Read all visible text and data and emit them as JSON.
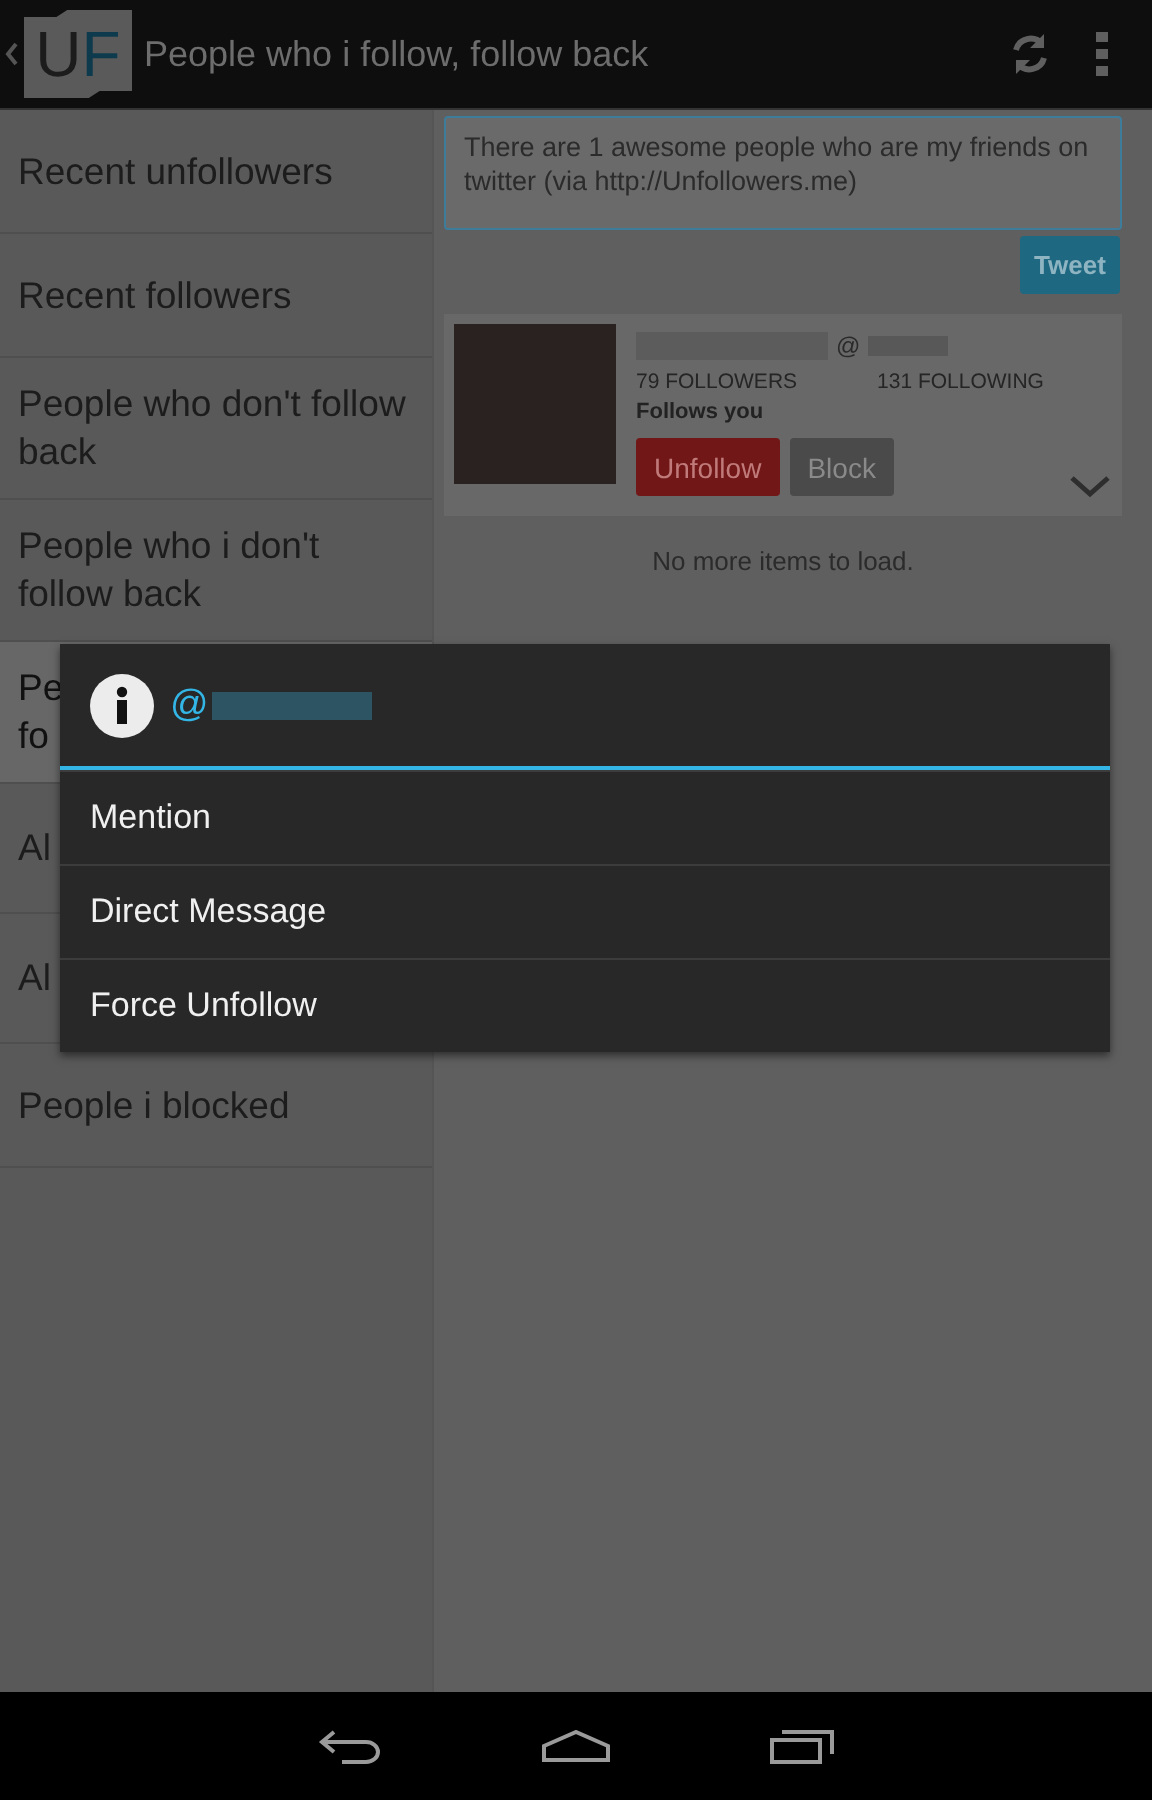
{
  "app_bar": {
    "logo_letters": [
      "U",
      "F"
    ],
    "title": "People who i follow, follow back"
  },
  "sidebar": {
    "items": [
      {
        "lines": [
          "Recent unfollowers"
        ],
        "selected": false
      },
      {
        "lines": [
          "Recent followers"
        ],
        "selected": false
      },
      {
        "lines": [
          "People who don't follow",
          "back"
        ],
        "selected": false
      },
      {
        "lines": [
          "People who i don't",
          "follow back"
        ],
        "selected": false
      },
      {
        "lines": [
          "Pe",
          "fo"
        ],
        "selected": true
      },
      {
        "lines": [
          "Al"
        ],
        "selected": false
      },
      {
        "lines": [
          "Al"
        ],
        "selected": false
      },
      {
        "lines": [
          "People i blocked"
        ],
        "selected": false
      }
    ]
  },
  "compose": {
    "message": "There are 1 awesome people who are my friends on twitter (via http://Unfollowers.me)",
    "tweet_button": "Tweet"
  },
  "user_card": {
    "handle_prefix": "@",
    "followers": "79 FOLLOWERS",
    "following": "131 FOLLOWING",
    "relation": "Follows you",
    "buttons": [
      {
        "label": "Unfollow",
        "kind": "danger"
      },
      {
        "label": "Block",
        "kind": "neutral"
      }
    ]
  },
  "list_footer": "No more items to load.",
  "dialog": {
    "title_prefix": "@",
    "items": [
      "Mention",
      "Direct Message",
      "Force Unfollow"
    ]
  }
}
